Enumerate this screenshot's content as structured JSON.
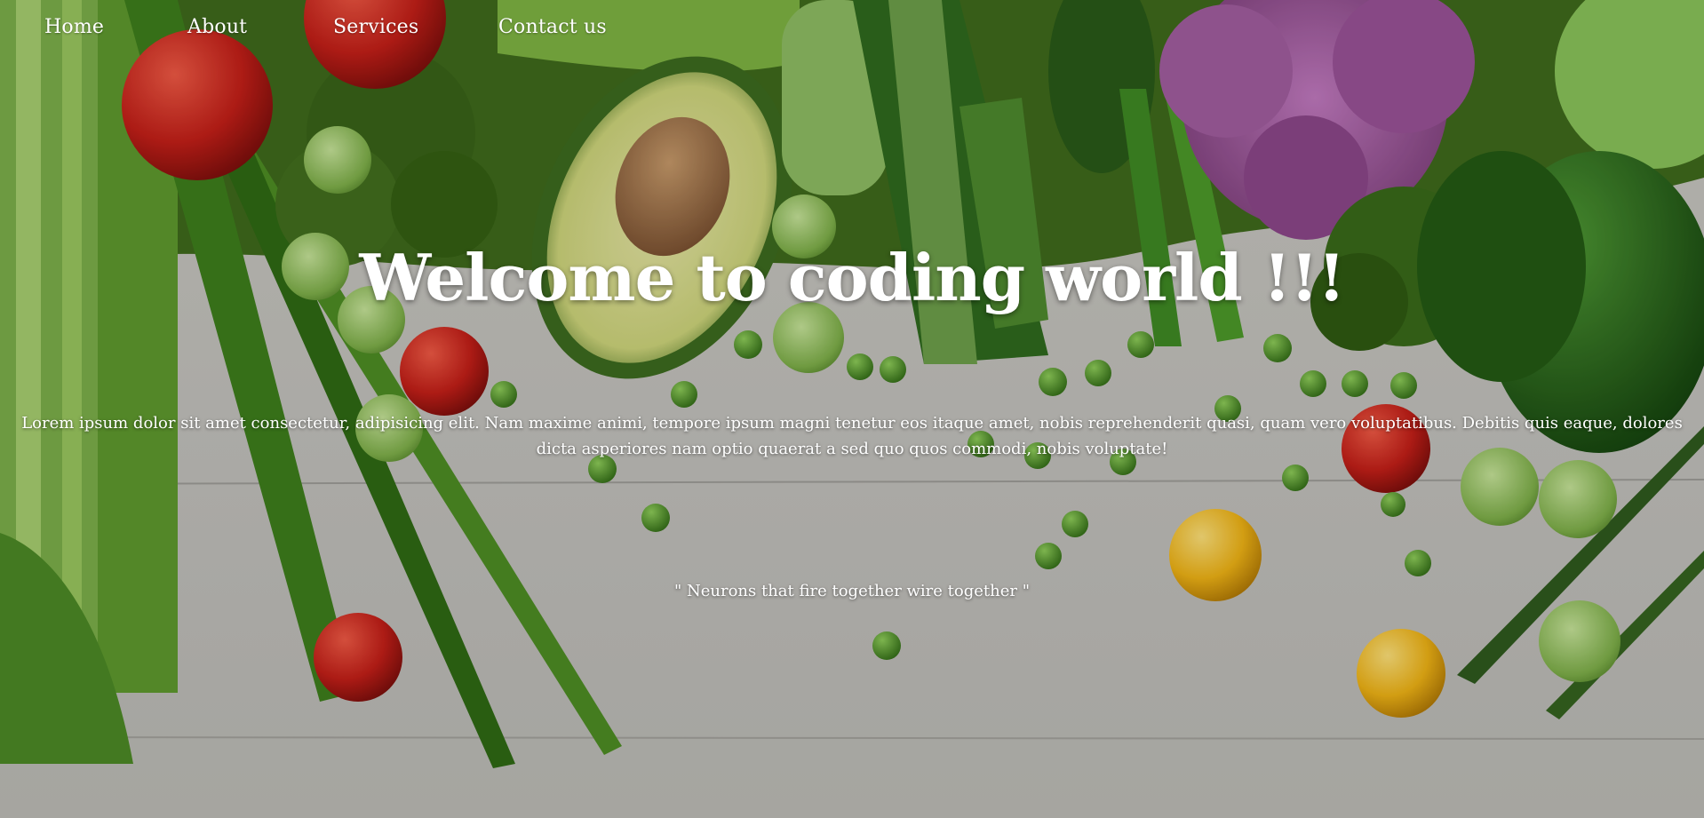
{
  "nav": {
    "home": "Home",
    "about": "About",
    "services": "Services",
    "contact": "Contact us"
  },
  "hero": {
    "title": "Welcome to coding world !!!",
    "paragraph": "Lorem ipsum dolor sit amet consectetur, adipisicing elit. Nam maxime animi, tempore ipsum magni tenetur eos itaque amet, nobis reprehenderit quasi, quam vero voluptatibus. Debitis quis eaque, dolores dicta asperiores nam optio quaerat a sed quo quos commodi, nobis voluptate!",
    "quote": "\" Neurons that fire together wire together \""
  },
  "colors": {
    "text": "#ffffff",
    "table": "#cdcdca",
    "celery": "#86b85a",
    "tomato": "#c8261e",
    "broccoli": "#3f6a1c",
    "cauliflower": "#a25ea0",
    "pepper": "#1f5c16",
    "yellow_tomato": "#e9b515"
  }
}
